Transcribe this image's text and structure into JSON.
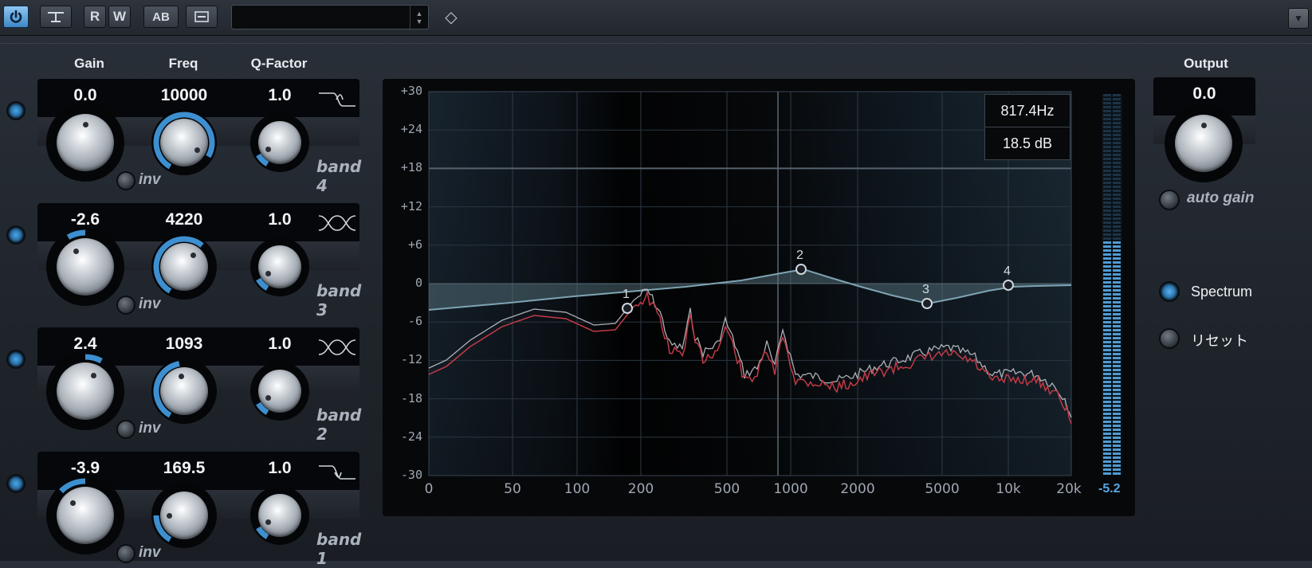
{
  "toolbar": {
    "power": "power-icon",
    "bypass": "bypass-icon",
    "read": "R",
    "write": "W",
    "ab": "AB",
    "preset_menu": "list-icon",
    "preset_value": "",
    "menu": "menu-arrow-icon"
  },
  "labels": {
    "gain": "Gain",
    "freq": "Freq",
    "q": "Q-Factor",
    "output": "Output"
  },
  "bands": [
    {
      "gain": "0.0",
      "freq": "10000",
      "q": "1.0",
      "name": "band 4",
      "inv": "inv",
      "shape": "high-shelf"
    },
    {
      "gain": "-2.6",
      "freq": "4220",
      "q": "1.0",
      "name": "band 3",
      "inv": "inv",
      "shape": "peak"
    },
    {
      "gain": "2.4",
      "freq": "1093",
      "q": "1.0",
      "name": "band 2",
      "inv": "inv",
      "shape": "peak"
    },
    {
      "gain": "-3.9",
      "freq": "169.5",
      "q": "1.0",
      "name": "band 1",
      "inv": "inv",
      "shape": "low-shelf"
    }
  ],
  "graph": {
    "y_ticks": [
      "+30",
      "+24",
      "+18",
      "+12",
      "+6",
      "0",
      "-6",
      "-12",
      "-18",
      "-24",
      "-30"
    ],
    "x_ticks": [
      "0",
      "50",
      "100",
      "200",
      "500",
      "1000",
      "2000",
      "5000",
      "10k",
      "20k"
    ],
    "readout_freq": "817.4Hz",
    "readout_db": "18.5 dB",
    "meter_value": "-5.2",
    "meter_level": 0.62,
    "handles": [
      "1",
      "2",
      "3",
      "4"
    ]
  },
  "output": {
    "gain": "0.0",
    "auto_gain": "auto gain"
  },
  "side": {
    "spectrum": "Spectrum",
    "reset": "リセット"
  },
  "colors": {
    "accent": "#3d8fd0",
    "spectrum_red": "#c23a47",
    "eq_curve": "#6b8c99"
  }
}
